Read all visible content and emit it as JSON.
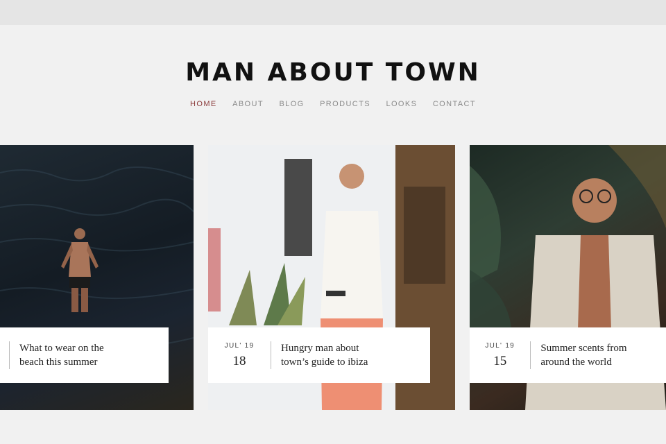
{
  "site": {
    "title": "MAN ABOUT TOWN"
  },
  "nav": {
    "items": [
      "HOME",
      "ABOUT",
      "BLOG",
      "PRODUCTS",
      "LOOKS",
      "CONTACT"
    ],
    "active": "HOME"
  },
  "posts": [
    {
      "title_line1": "What to wear on the",
      "title_line2": "beach this summer",
      "month": "",
      "day": ""
    },
    {
      "title_line1": "Hungry man about",
      "title_line2": "town’s guide to ibiza",
      "month": "JUL' 19",
      "day": "18"
    },
    {
      "title_line1": "Summer scents from",
      "title_line2": "around the world",
      "month": "JUL' 19",
      "day": "15"
    }
  ],
  "colors": {
    "background": "#f1f1f1",
    "topbar": "#e5e5e5",
    "nav_active": "#8b3b3b",
    "nav_inactive": "#8a8a8a",
    "title": "#111111"
  }
}
